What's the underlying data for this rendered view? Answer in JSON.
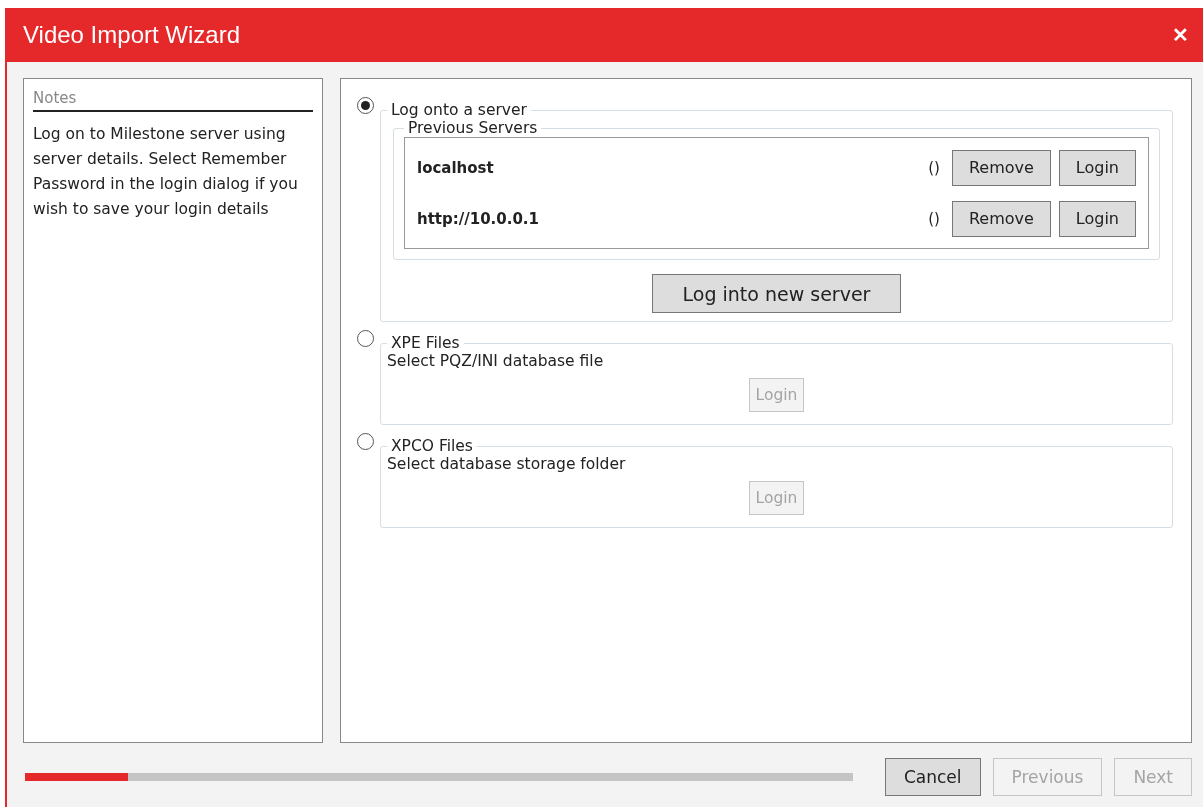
{
  "window": {
    "title": "Video Import Wizard",
    "close": "✕"
  },
  "notes": {
    "heading": "Notes",
    "text": "Log on to Milestone server using server details. Select Remember Password in the login dialog if you wish to save your login details"
  },
  "options": [
    {
      "kind": "server",
      "label": "Log onto a server",
      "selected": true,
      "group": {
        "label": "Previous Servers",
        "servers": [
          {
            "name": "localhost",
            "suffix": "()",
            "buttons": [
              {
                "label": "Remove",
                "disabled": false
              },
              {
                "label": "Login",
                "disabled": false
              }
            ]
          },
          {
            "name": "http://10.0.0.1",
            "suffix": "()",
            "buttons": [
              {
                "label": "Remove",
                "disabled": false
              },
              {
                "label": "Login",
                "disabled": false
              }
            ]
          }
        ]
      },
      "button": {
        "label": "Log into new server",
        "disabled": false
      }
    },
    {
      "kind": "file",
      "label": "XPE Files",
      "selected": false,
      "description": "Select PQZ/INI database file",
      "button": {
        "label": "Login",
        "disabled": true
      }
    },
    {
      "kind": "file",
      "label": "XPCO Files",
      "selected": false,
      "description": "Select database storage folder",
      "button": {
        "label": "Login",
        "disabled": true
      }
    }
  ],
  "progress": {
    "level": 0.125
  },
  "footer_buttons": [
    {
      "label": "Cancel",
      "disabled": false
    },
    {
      "label": "Previous",
      "disabled": true
    },
    {
      "label": "Next",
      "disabled": true
    }
  ]
}
